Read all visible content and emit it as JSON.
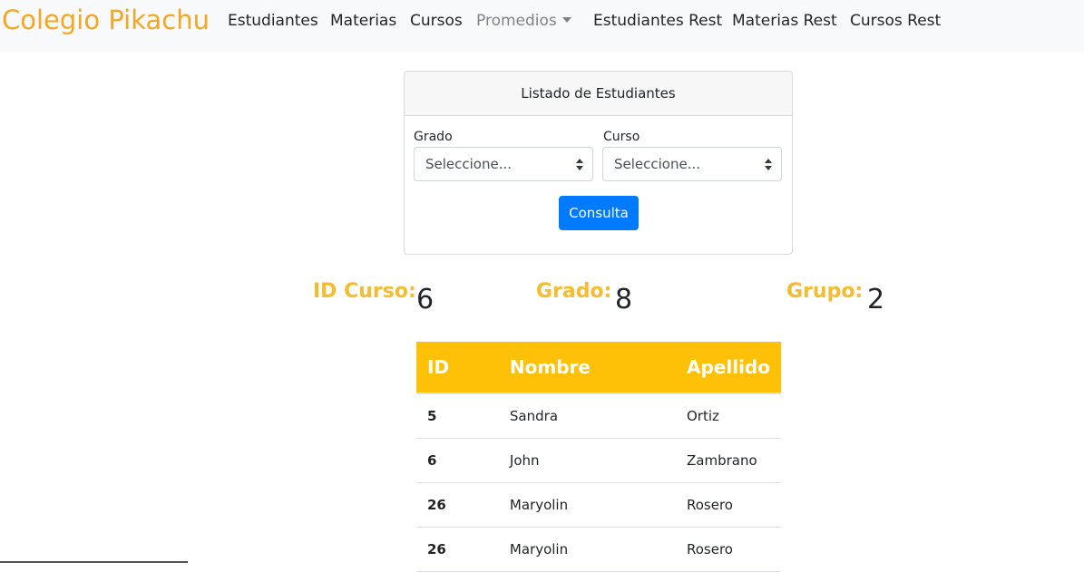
{
  "navbar": {
    "brand": "Colegio Pikachu",
    "items": [
      {
        "label": "Estudiantes"
      },
      {
        "label": "Materias"
      },
      {
        "label": "Cursos"
      },
      {
        "label": "Promedios"
      },
      {
        "label": "Estudiantes Rest"
      },
      {
        "label": "Materias Rest"
      },
      {
        "label": "Cursos Rest"
      }
    ]
  },
  "card": {
    "title": "Listado de Estudiantes",
    "grado": {
      "label": "Grado",
      "value": "Seleccione..."
    },
    "curso": {
      "label": "Curso",
      "value": "Seleccione..."
    },
    "button": "Consulta"
  },
  "info": {
    "id_curso_label": "ID Curso:",
    "id_curso_value": "6",
    "grado_label": "Grado:",
    "grado_value": "8",
    "grupo_label": "Grupo:",
    "grupo_value": "2"
  },
  "table": {
    "headers": [
      "ID",
      "Nombre",
      "Apellido"
    ],
    "rows": [
      [
        "5",
        "Sandra",
        "Ortiz"
      ],
      [
        "6",
        "John",
        "Zambrano"
      ],
      [
        "26",
        "Maryolin",
        "Rosero"
      ],
      [
        "26",
        "Maryolin",
        "Rosero"
      ]
    ]
  },
  "colors": {
    "brand": "#f5a623",
    "accent": "#ffc107",
    "label": "#f7bb2f",
    "primary": "#007bff"
  }
}
